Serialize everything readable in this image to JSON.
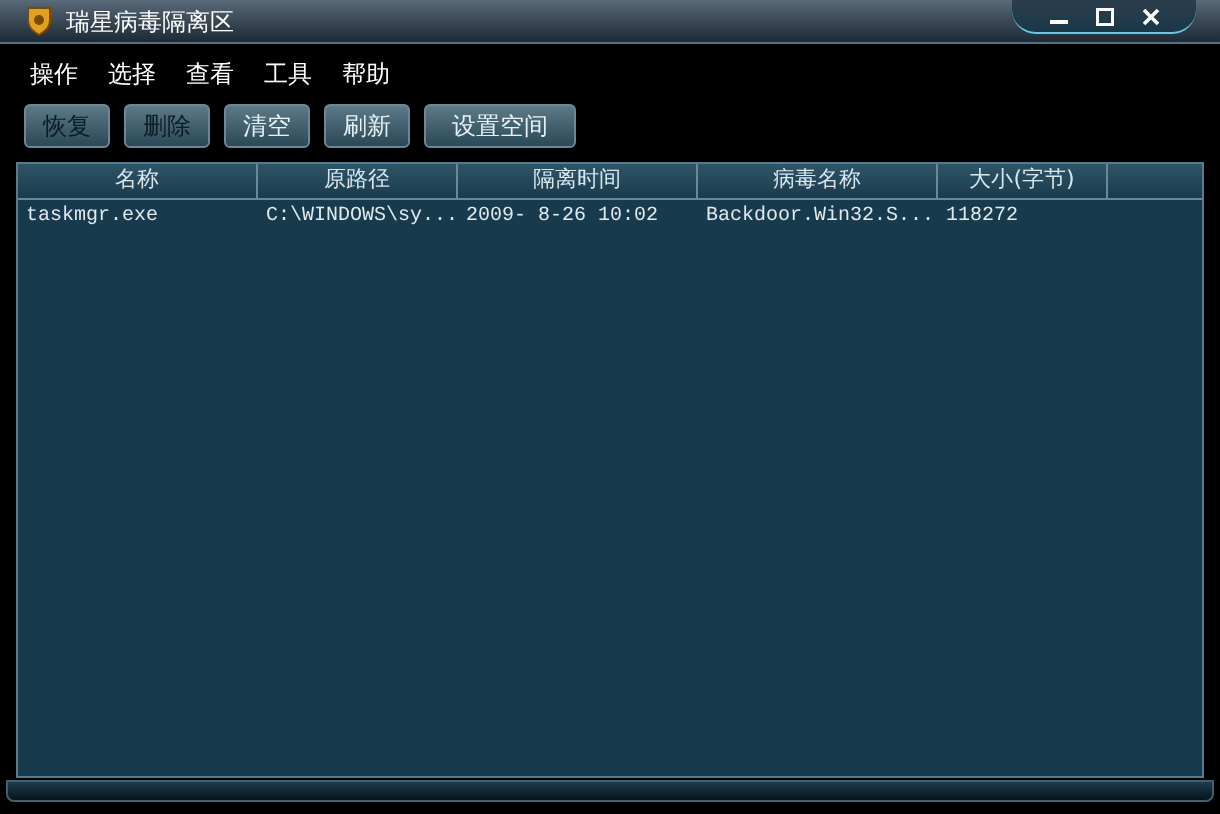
{
  "window": {
    "title": "瑞星病毒隔离区"
  },
  "menu": [
    "操作",
    "选择",
    "查看",
    "工具",
    "帮助"
  ],
  "toolbar": [
    {
      "label": "恢复",
      "disabled": true
    },
    {
      "label": "删除",
      "disabled": true
    },
    {
      "label": "清空",
      "disabled": false
    },
    {
      "label": "刷新",
      "disabled": false
    },
    {
      "label": "设置空间",
      "disabled": false
    }
  ],
  "table": {
    "columns": [
      "名称",
      "原路径",
      "隔离时间",
      "病毒名称",
      "大小(字节)"
    ],
    "rows": [
      [
        "taskmgr.exe",
        "C:\\WINDOWS\\sy...",
        "2009- 8-26 10:02",
        "Backdoor.Win32.S...",
        "118272"
      ]
    ]
  }
}
